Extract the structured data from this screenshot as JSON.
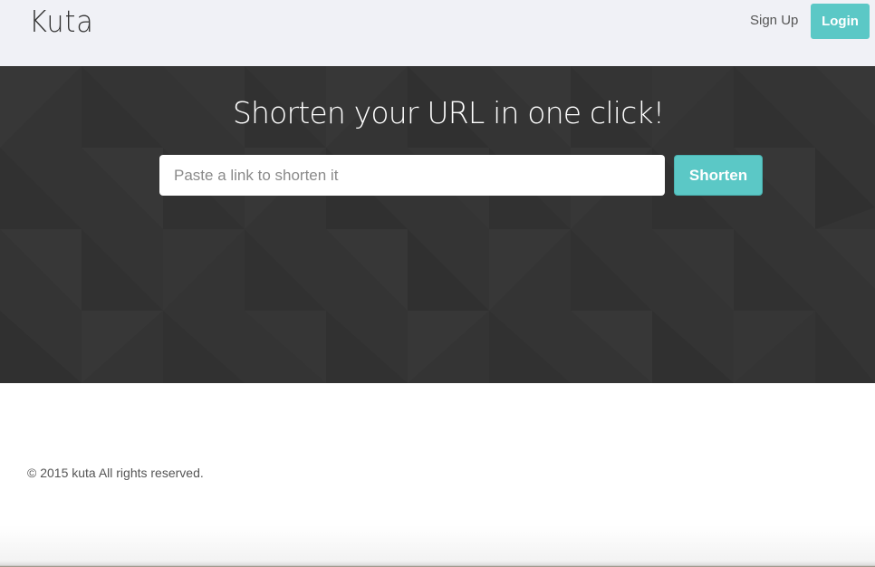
{
  "brand": {
    "name": "Kuta"
  },
  "nav": {
    "signup_label": "Sign Up",
    "login_label": "Login"
  },
  "hero": {
    "title": "Shorten your URL in one click!",
    "input_placeholder": "Paste a link to shorten it",
    "input_value": "",
    "button_label": "Shorten"
  },
  "footer": {
    "copyright": "© 2015 kuta All rights reserved."
  },
  "colors": {
    "accent": "#5bc8c6",
    "navbar_bg": "#f0f1f6",
    "hero_bg": "#343434"
  }
}
